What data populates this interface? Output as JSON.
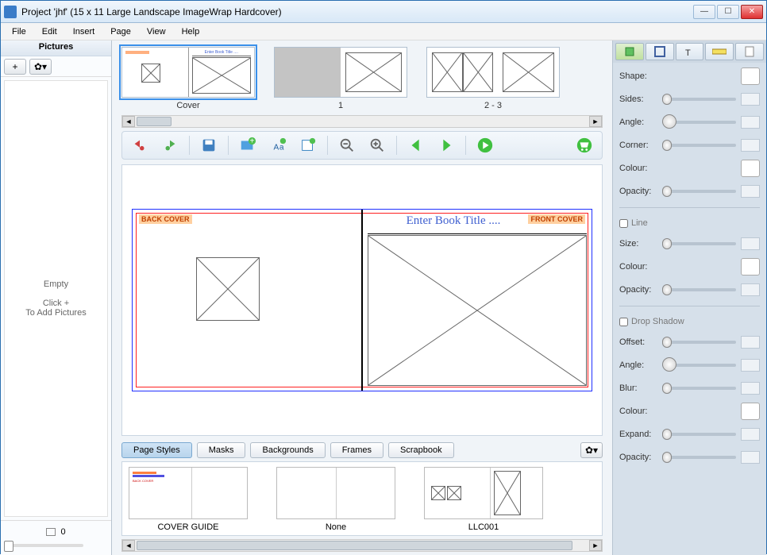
{
  "window": {
    "title": "Project 'jhf' (15 x 11 Large Landscape ImageWrap Hardcover)"
  },
  "menu": [
    "File",
    "Edit",
    "Insert",
    "Page",
    "View",
    "Help"
  ],
  "left_panel": {
    "header": "Pictures",
    "empty_line1": "Empty",
    "empty_line2": "Click +",
    "empty_line3": "To Add Pictures",
    "footer_count": "0"
  },
  "thumbnails": [
    {
      "label": "Cover"
    },
    {
      "label": "1"
    },
    {
      "label": "2 - 3"
    }
  ],
  "canvas": {
    "back_label": "BACK COVER",
    "front_label": "FRONT COVER",
    "title_placeholder": "Enter Book Title ...."
  },
  "bottom_tabs": [
    "Page Styles",
    "Masks",
    "Backgrounds",
    "Frames",
    "Scrapbook"
  ],
  "styles": [
    {
      "label": "COVER GUIDE"
    },
    {
      "label": "None"
    },
    {
      "label": "LLC001"
    }
  ],
  "right_panel": {
    "shape_section": {
      "shape": "Shape:",
      "sides": "Sides:",
      "angle": "Angle:",
      "corner": "Corner:",
      "colour": "Colour:",
      "opacity": "Opacity:"
    },
    "line_section": {
      "header": "Line",
      "size": "Size:",
      "colour": "Colour:",
      "opacity": "Opacity:"
    },
    "shadow_section": {
      "header": "Drop Shadow",
      "offset": "Offset:",
      "angle": "Angle:",
      "blur": "Blur:",
      "colour": "Colour:",
      "expand": "Expand:",
      "opacity": "Opacity:"
    }
  }
}
